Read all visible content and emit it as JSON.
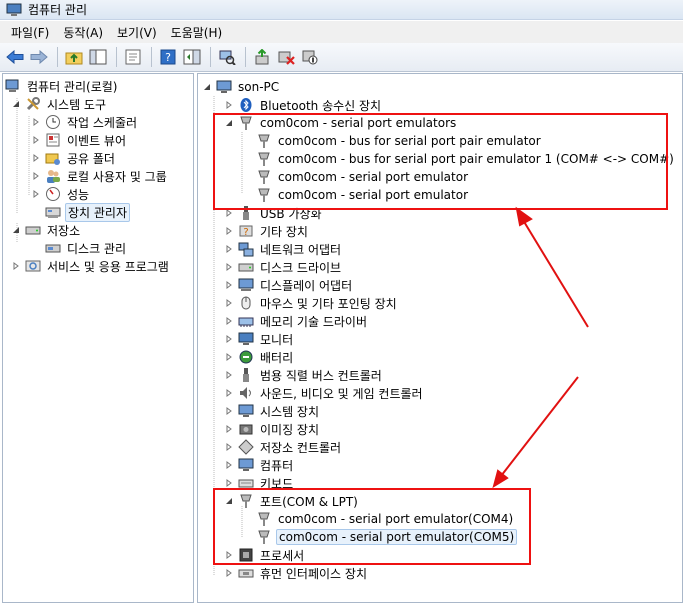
{
  "window": {
    "title": "컴퓨터 관리"
  },
  "menu": [
    "파일(F)",
    "동작(A)",
    "보기(V)",
    "도움말(H)"
  ],
  "toolbar_icons": [
    "back-icon",
    "forward-icon",
    "folder-up-icon",
    "show-hide-tree-icon",
    "properties-icon",
    "help-icon",
    "show-action-pane-icon",
    "scan-hardware-icon",
    "update-driver-icon",
    "uninstall-icon",
    "disable-icon"
  ],
  "left_tree": {
    "root": "컴퓨터 관리(로컬)",
    "system_tools": "시스템 도구",
    "task_scheduler": "작업 스케줄러",
    "event_viewer": "이벤트 뷰어",
    "shared_folders": "공유 폴더",
    "local_users": "로컬 사용자 및 그룹",
    "performance": "성능",
    "device_manager": "장치 관리자",
    "storage": "저장소",
    "disk_management": "디스크 관리",
    "services_apps": "서비스 및 응용 프로그램"
  },
  "right_tree": {
    "root": "son-PC",
    "bluetooth": "Bluetooth 송수신 장치",
    "com0com_group": "com0com - serial port emulators",
    "com0com_children": [
      "com0com - bus for serial port pair emulator",
      "com0com - bus for serial port pair emulator 1 (COM# <-> COM#)",
      "com0com - serial port emulator",
      "com0com - serial port emulator"
    ],
    "categories": [
      "USB 가상화",
      "기타 장치",
      "네트워크 어댑터",
      "디스크 드라이브",
      "디스플레이 어댑터",
      "마우스 및 기타 포인팅 장치",
      "메모리 기술 드라이버",
      "모니터",
      "배터리",
      "범용 직렬 버스 컨트롤러",
      "사운드, 비디오 및 게임 컨트롤러",
      "시스템 장치",
      "이미징 장치",
      "저장소 컨트롤러",
      "컴퓨터",
      "키보드"
    ],
    "ports_group": "포트(COM & LPT)",
    "ports_children": [
      "com0com - serial port emulator(COM4)",
      "com0com - serial port emulator(COM5)"
    ],
    "processor": "프로세서",
    "hid": "휴먼 인터페이스 장치"
  },
  "colors": {
    "annotation": "#e11111",
    "selection_fill": "#e7f1fb",
    "selection_border": "#a9c8ea"
  }
}
